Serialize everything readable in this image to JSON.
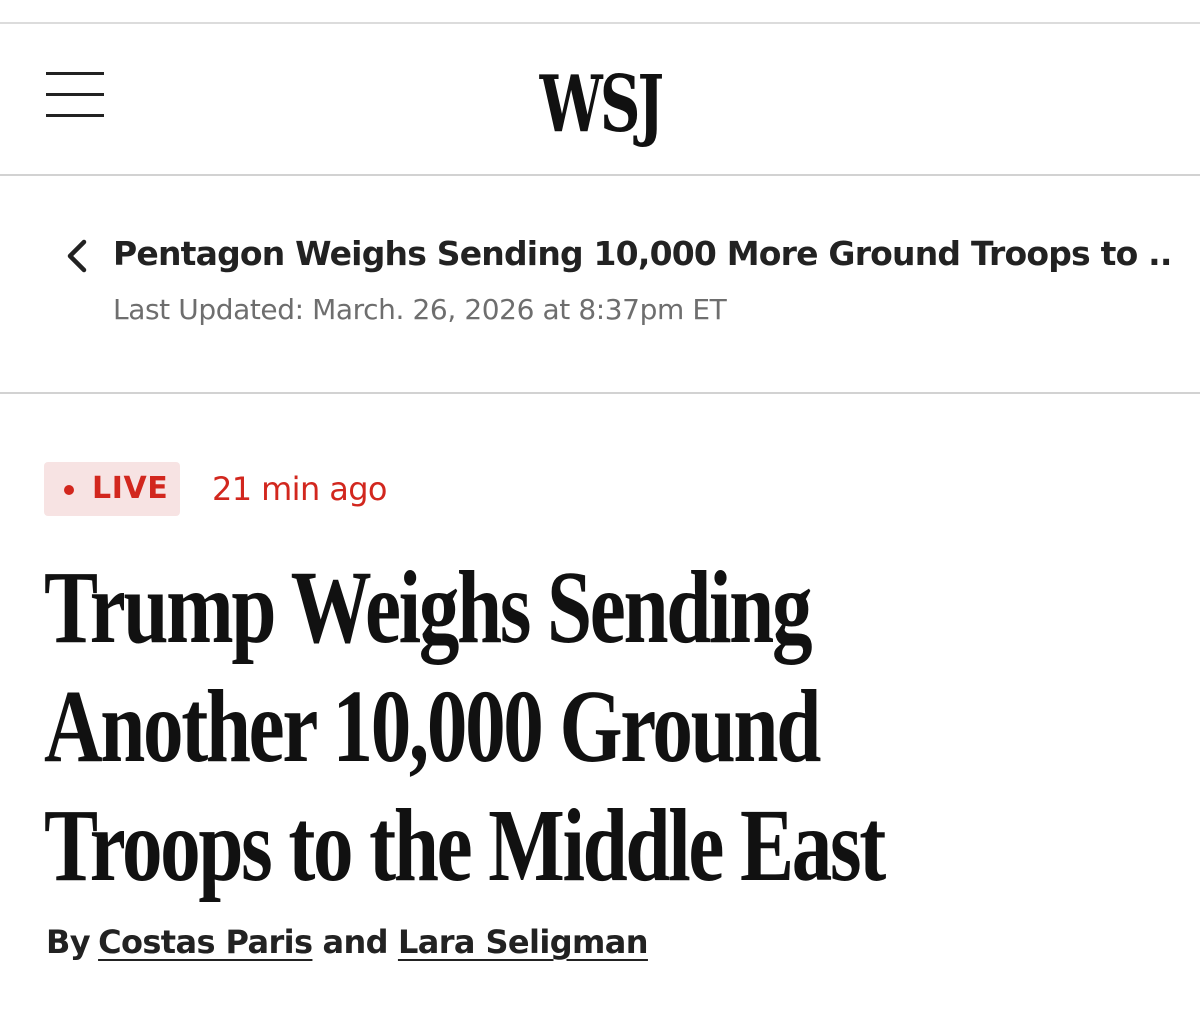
{
  "masthead": {
    "logo": "WSJ"
  },
  "story_nav": {
    "parent_headline": "Pentagon Weighs Sending 10,000 More Ground Troops to ...",
    "last_updated": "Last Updated: March. 26, 2026 at 8:37pm ET"
  },
  "article": {
    "live_label": "LIVE",
    "time_ago": "21 min ago",
    "headline_lines": [
      "Trump Weighs Sending",
      "Another 10,000 Ground",
      "Troops to the Middle East"
    ],
    "byline": {
      "by": "By",
      "author_1": "Costas Paris",
      "and": "and",
      "author_2": "Lara Seligman"
    }
  },
  "colors": {
    "live_red": "#d2271e",
    "live_badge_bg": "#f7e3e3",
    "divider": "#d2d2d2",
    "muted_text": "#6e6e6e"
  },
  "icons": {
    "menu": "hamburger-menu-icon",
    "back": "chevron-left-icon",
    "live": "live-dot-icon"
  }
}
